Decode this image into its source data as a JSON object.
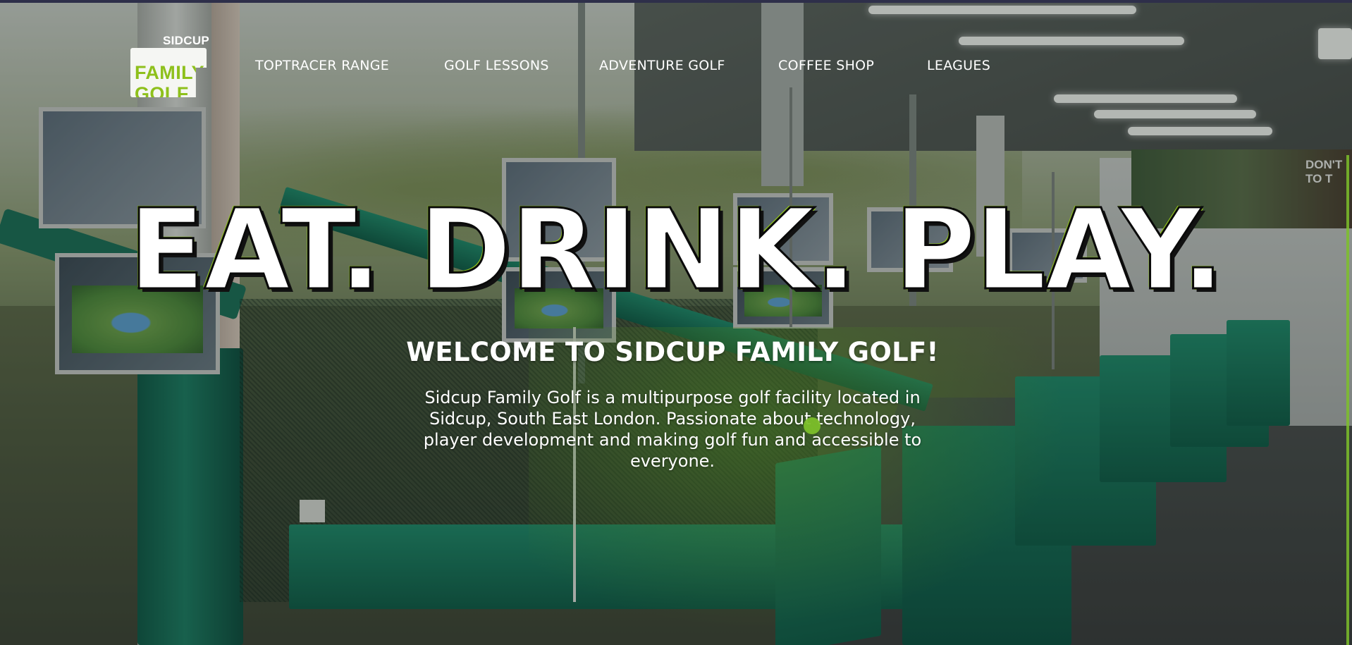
{
  "logo": {
    "top_text": "SIDCUP",
    "line1": "FAMILY",
    "line2": "GOLF"
  },
  "nav": {
    "items": [
      {
        "label": "TOPTRACER RANGE"
      },
      {
        "label": "GOLF LESSONS"
      },
      {
        "label": "ADVENTURE GOLF"
      },
      {
        "label": "COFFEE SHOP"
      },
      {
        "label": "LEAGUES"
      }
    ]
  },
  "hero": {
    "title": "EAT. DRINK. PLAY.",
    "welcome": "WELCOME TO SIDCUP FAMILY GOLF!",
    "description": "Sidcup Family Golf is a multipurpose golf facility located in Sidcup, South East London. Passionate about technology, player development and making golf fun and accessible to everyone."
  },
  "background": {
    "poster_text": "DON'T TO T",
    "post_logo_text": "SIDCUP FAMILY GOLF"
  },
  "colors": {
    "brand_green": "#8ec01c",
    "text": "#ffffff"
  }
}
